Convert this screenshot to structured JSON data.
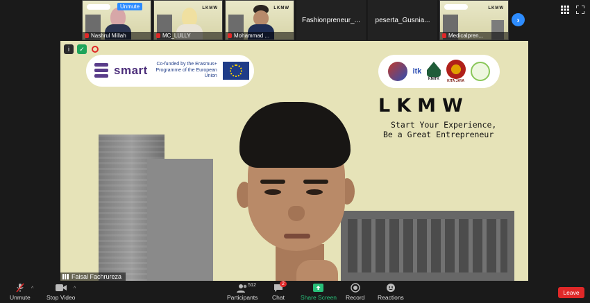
{
  "thumbnails": [
    {
      "name": "Nashrul Millah",
      "kind": "video",
      "popup": "Unmute"
    },
    {
      "name": "MC_LULLY",
      "kind": "video"
    },
    {
      "name": "Mohammad ...",
      "kind": "video"
    },
    {
      "name": "Fashionpreneur_...",
      "kind": "text"
    },
    {
      "name": "peserta_Gusnia...",
      "kind": "text"
    },
    {
      "name": "Medicalpren...",
      "kind": "video"
    }
  ],
  "main_video": {
    "speaker_name": "Faisal Fachrureza",
    "logo_smart": "smart",
    "cofunded_text": "Co-funded by the Erasmus+ Programme of the European Union",
    "partner_itk": "itk",
    "partner_kmitk": "KMITK",
    "partner_kitajaya": "KITA JAYA",
    "title": "LKMW",
    "tagline_1": "Start Your Experience,",
    "tagline_2": "Be a Great Entrepreneur"
  },
  "toolbar": {
    "unmute": "Unmute",
    "stop_video": "Stop Video",
    "participants": "Participants",
    "participants_count": "512",
    "chat": "Chat",
    "chat_badge": "2",
    "share_screen": "Share Screen",
    "record": "Record",
    "reactions": "Reactions",
    "leave": "Leave"
  },
  "colors": {
    "accent": "#2d8cff",
    "share_green": "#29c07a",
    "leave_red": "#e02828"
  }
}
